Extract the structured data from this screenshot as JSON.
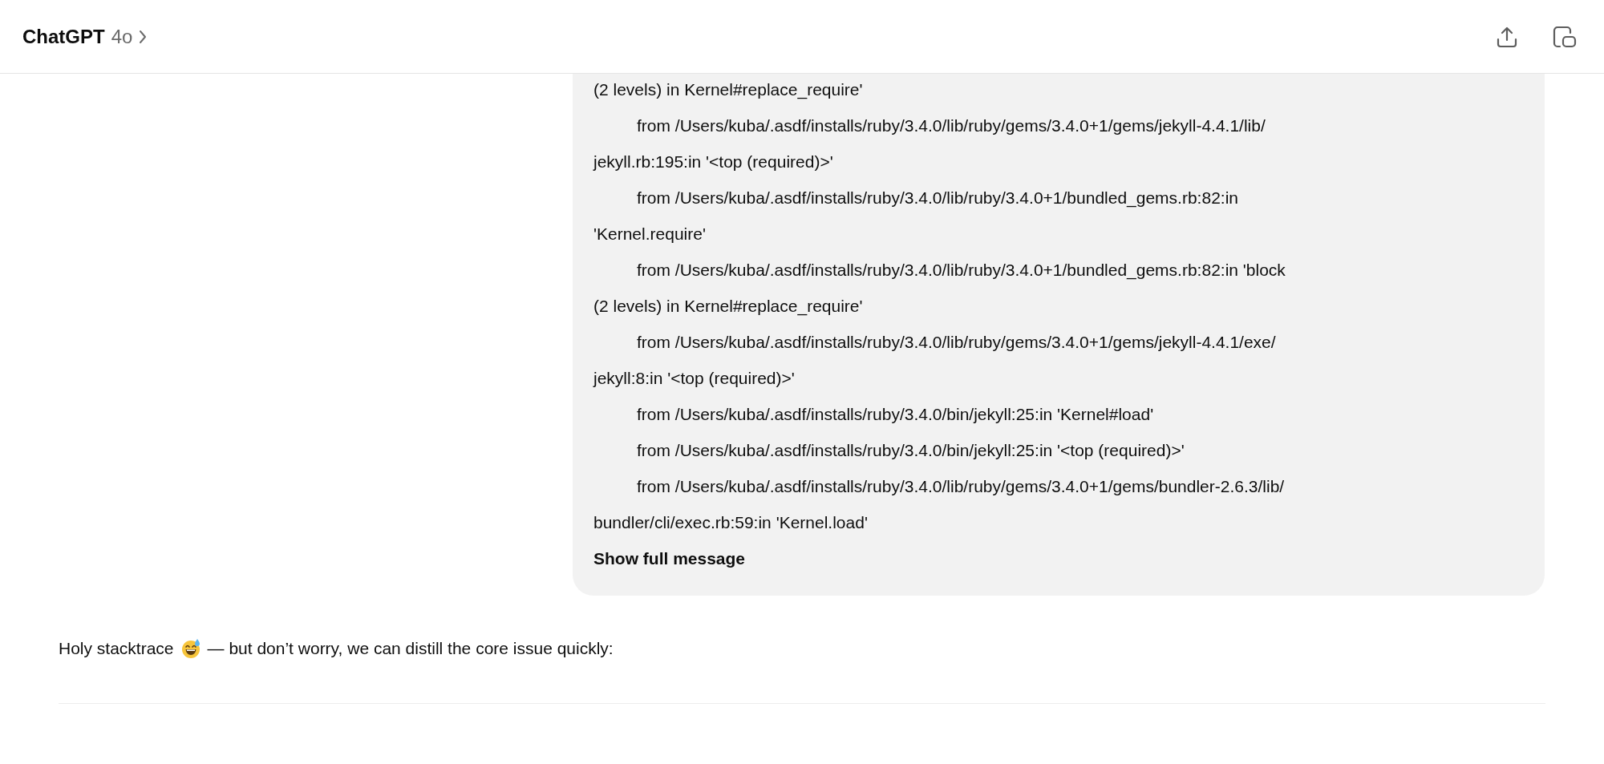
{
  "header": {
    "title": "ChatGPT",
    "model": "4o"
  },
  "user_message": {
    "lines": [
      {
        "kind": "continuation",
        "text": "(2 levels) in Kernel#replace_require'"
      },
      {
        "kind": "frame",
        "text": "from /Users/kuba/.asdf/installs/ruby/3.4.0/lib/ruby/gems/3.4.0+1/gems/jekyll-4.4.1/lib/"
      },
      {
        "kind": "continuation",
        "text": "jekyll.rb:195:in '<top (required)>'"
      },
      {
        "kind": "frame",
        "text": "from /Users/kuba/.asdf/installs/ruby/3.4.0/lib/ruby/3.4.0+1/bundled_gems.rb:82:in"
      },
      {
        "kind": "continuation",
        "text": "'Kernel.require'"
      },
      {
        "kind": "frame",
        "text": "from /Users/kuba/.asdf/installs/ruby/3.4.0/lib/ruby/3.4.0+1/bundled_gems.rb:82:in 'block"
      },
      {
        "kind": "continuation",
        "text": "(2 levels) in Kernel#replace_require'"
      },
      {
        "kind": "frame",
        "text": "from /Users/kuba/.asdf/installs/ruby/3.4.0/lib/ruby/gems/3.4.0+1/gems/jekyll-4.4.1/exe/"
      },
      {
        "kind": "continuation",
        "text": "jekyll:8:in '<top (required)>'"
      },
      {
        "kind": "frame",
        "text": "from /Users/kuba/.asdf/installs/ruby/3.4.0/bin/jekyll:25:in 'Kernel#load'"
      },
      {
        "kind": "frame",
        "text": "from /Users/kuba/.asdf/installs/ruby/3.4.0/bin/jekyll:25:in '<top (required)>'"
      },
      {
        "kind": "frame",
        "text": "from /Users/kuba/.asdf/installs/ruby/3.4.0/lib/ruby/gems/3.4.0+1/gems/bundler-2.6.3/lib/"
      },
      {
        "kind": "continuation",
        "text": "bundler/cli/exec.rb:59:in 'Kernel.load'"
      }
    ],
    "show_more": "Show full message"
  },
  "assistant_message": {
    "before": "Holy stacktrace",
    "after": "— but don’t worry, we can distill the core issue quickly:"
  }
}
